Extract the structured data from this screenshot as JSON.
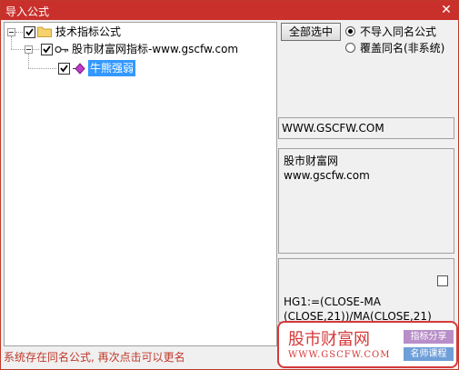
{
  "window": {
    "title": "导入公式",
    "close_glyph": "✕"
  },
  "tree": {
    "root": {
      "label": "技术指标公式",
      "checked": true
    },
    "group": {
      "label": "股市财富网指标-www.gscfw.com",
      "checked": true
    },
    "item": {
      "label": "牛熊强弱",
      "checked": true,
      "selected": true
    }
  },
  "controls": {
    "select_all_label": "全部选中",
    "options": [
      {
        "label": "不导入同名公式",
        "selected": true
      },
      {
        "label": "覆盖同名(非系统)",
        "selected": false
      }
    ]
  },
  "panel": {
    "url_text": "WWW.GSCFW.COM",
    "desc_line1": "股市财富网",
    "desc_line2": "www.gscfw.com",
    "code_line1": "HG1:=(CLOSE-MA",
    "code_line2": "(CLOSE,21))/MA(CLOSE,21)"
  },
  "status_text": "系统存在同名公式, 再次点击可以更名",
  "watermark": {
    "site_name": "股市财富网",
    "site_url": "WWW.GSCFW.COM",
    "badge1": "指标分享",
    "badge2": "名师课程"
  },
  "icons": [
    "folder-icon",
    "key-icon",
    "formula-icon",
    "checkbox-check-icon",
    "close-icon"
  ],
  "colors": {
    "titlebar": "#c9302c",
    "selection": "#3399ff",
    "status": "#c0392b"
  }
}
